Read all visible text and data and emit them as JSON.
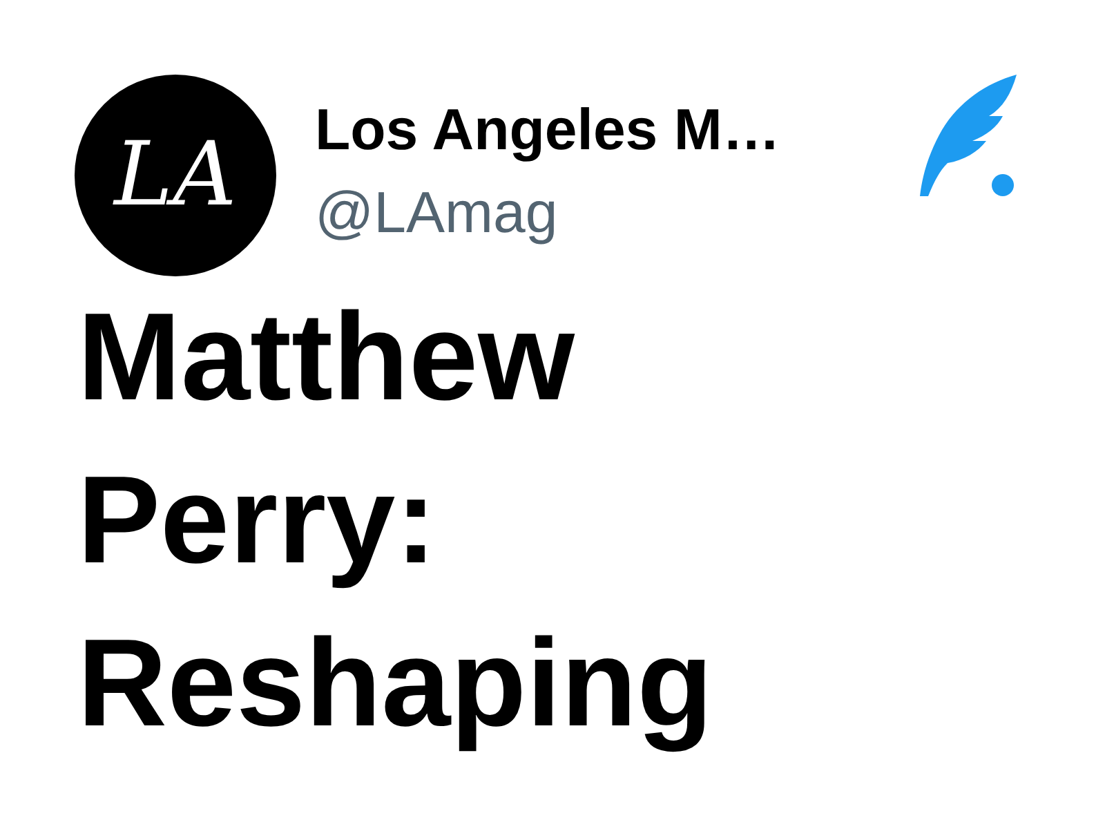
{
  "author": {
    "avatar_text": "LA",
    "name": "Los Angeles M…",
    "handle": "@LAmag"
  },
  "headline": "Matthew Perry: Reshaping"
}
